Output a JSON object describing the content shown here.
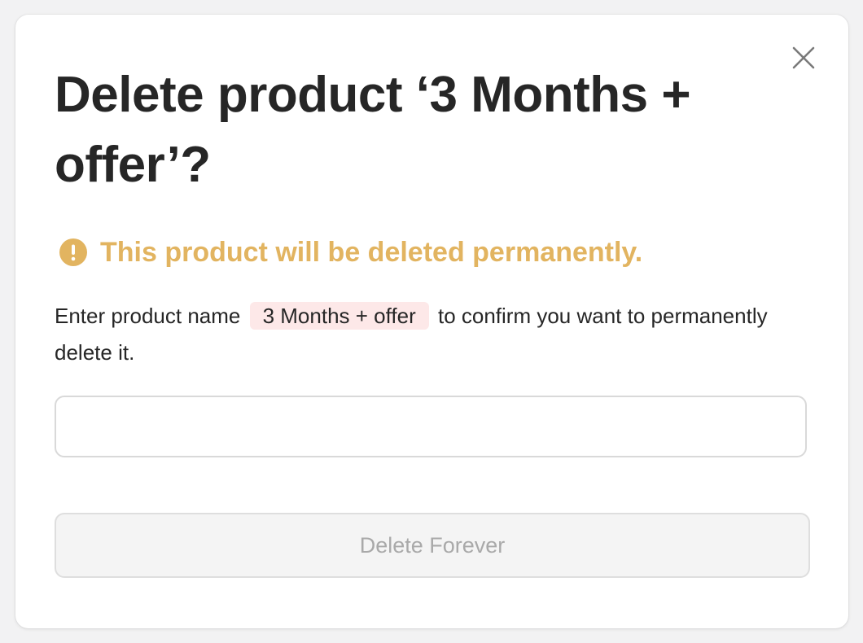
{
  "modal": {
    "title": "Delete product ‘3 Months + offer’?",
    "close_icon": "close-icon",
    "warning": {
      "icon": "exclamation-circle-icon",
      "text": "This product will be deleted permanently.",
      "color": "#e2b460"
    },
    "instructions": {
      "before": "Enter product name",
      "product_name": "3 Months + offer",
      "after": "to confirm you want to permanently delete it."
    },
    "confirm_input": {
      "value": "",
      "placeholder": ""
    },
    "delete_button_label": "Delete Forever",
    "chip_background": "#fde8e8"
  }
}
